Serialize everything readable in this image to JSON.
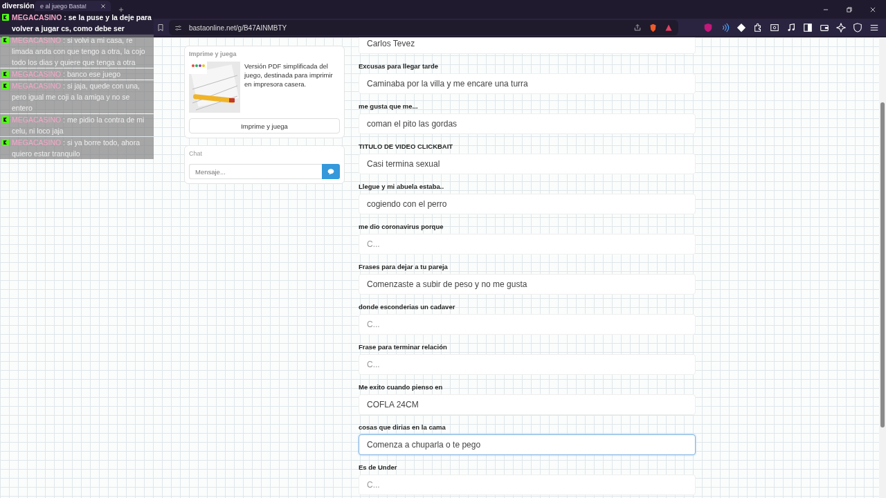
{
  "browser": {
    "tab": {
      "title": "e al juego Basta!"
    },
    "address": "bastaonline.net/g/B47AINMBTY"
  },
  "overlay_chat": {
    "messages": [
      {
        "kind": "new",
        "text": "diversión"
      },
      {
        "kind": "new",
        "user": "MEGACASINO",
        "text": ": se la puse y la deje para volver a jugar cs, como debe ser"
      },
      {
        "kind": "old",
        "user": "MEGACASINO",
        "text": ": si volvi a mi casa, re limada anda con que tengo a otra, la cojo todo los dias y quiere que tenga a otra"
      },
      {
        "kind": "old",
        "user": "MEGACASINO",
        "text": ": banco ese juego"
      },
      {
        "kind": "old",
        "user": "MEGACASINO",
        "text": ": si jaja, quede con una, pero igual me coji a la amiga y no se entero"
      },
      {
        "kind": "old",
        "user": "MEGACASINO",
        "text": ": me pidio la contra de mi celu, ni loco jaja"
      },
      {
        "kind": "old",
        "user": "MEGACASINO",
        "text": ": si ya borre todo, ahora quiero estar tranquilo"
      }
    ]
  },
  "print_card": {
    "title": "Imprime y juega",
    "description": "Versión PDF simplificada del juego, destinada para imprimir en impresora casera.",
    "button": "Imprime y juega"
  },
  "chat": {
    "title": "Chat",
    "placeholder": "Mensaje..."
  },
  "fields": [
    {
      "value": "Carlos Tevez",
      "focused": false
    },
    {
      "label": "Excusas para llegar tarde",
      "value": "Caminaba por la villa y me encare una turra",
      "focused": false
    },
    {
      "label": "me gusta que me...",
      "value": "coman el pito las gordas",
      "focused": false
    },
    {
      "label": "TITULO DE VIDEO CLICKBAIT",
      "value": "Casi termina sexual",
      "focused": false
    },
    {
      "label": "Llegue y mi abuela estaba..",
      "value": "cogiendo con el perro",
      "focused": false
    },
    {
      "label": "me dio coronavirus porque",
      "placeholder": "C...",
      "focused": false
    },
    {
      "label": "Frases para dejar a tu pareja",
      "value": "Comenzaste a subir de peso y no me gusta",
      "focused": false
    },
    {
      "label": "donde esconderias un cadaver",
      "placeholder": "C...",
      "focused": false
    },
    {
      "label": "Frase para terminar relación",
      "placeholder": "C...",
      "focused": false
    },
    {
      "label": "Me exito cuando pienso en",
      "value": "COFLA 24CM",
      "focused": false
    },
    {
      "label": "cosas que dirias en la cama",
      "value": "Comenza a chuparla o te pego",
      "focused": true
    },
    {
      "label": "Es de Under",
      "placeholder": "C...",
      "focused": false
    }
  ]
}
